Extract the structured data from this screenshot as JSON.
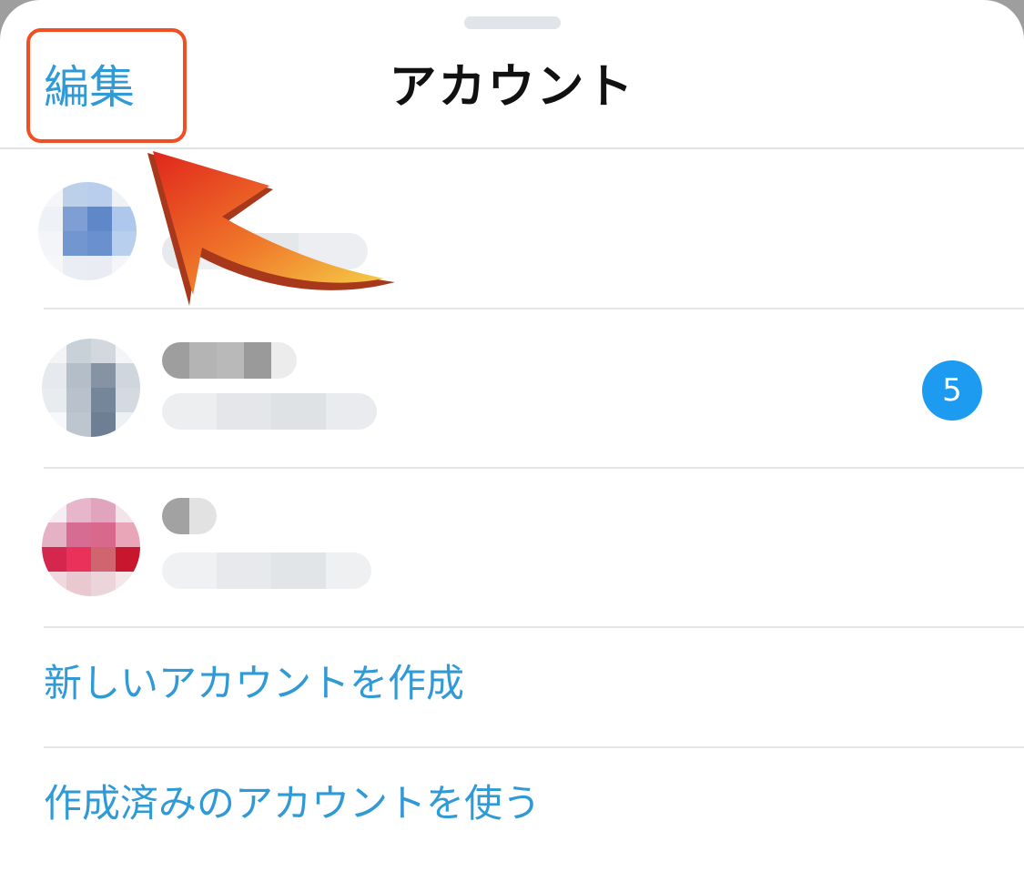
{
  "header": {
    "edit_label": "編集",
    "title": "アカウント"
  },
  "accounts": [
    {
      "avatar_palette": "blue",
      "unread_badge": null
    },
    {
      "avatar_palette": "gray",
      "unread_badge": "5"
    },
    {
      "avatar_palette": "pink",
      "unread_badge": null
    }
  ],
  "actions": {
    "create_account": "新しいアカウントを作成",
    "use_existing_account": "作成済みのアカウントを使う"
  },
  "colors": {
    "link": "#2f9ad6",
    "badge": "#1d9bf0",
    "highlight": "#f04f23"
  }
}
